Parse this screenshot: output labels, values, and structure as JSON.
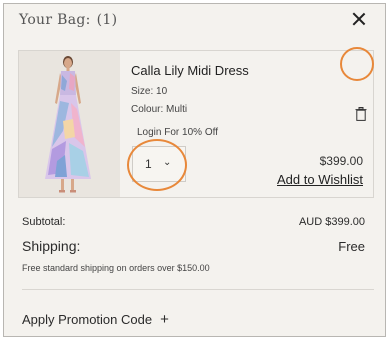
{
  "bag": {
    "title": "Your Bag:",
    "count": "(1)",
    "close_icon": "close-icon"
  },
  "item": {
    "name": "Calla Lily Midi Dress",
    "size": "Size: 10",
    "colour": "Colour: Multi",
    "login_offer": "Login For 10% Off",
    "quantity": "1",
    "chevron": "⌄",
    "price": "$399.00",
    "wishlist_label": "Add to Wishlist",
    "trash_icon": "trash-icon"
  },
  "summary": {
    "subtotal_label": "Subtotal:",
    "subtotal_value": "AUD $399.00",
    "shipping_label": "Shipping:",
    "shipping_value": "Free",
    "shipping_note": "Free standard shipping on orders over $150.00"
  },
  "promo": {
    "label": "Apply Promotion Code",
    "plus": "+"
  },
  "colors": {
    "background": "#f4f2ee",
    "highlight": "#e8883a",
    "text": "#2b2b2b"
  }
}
